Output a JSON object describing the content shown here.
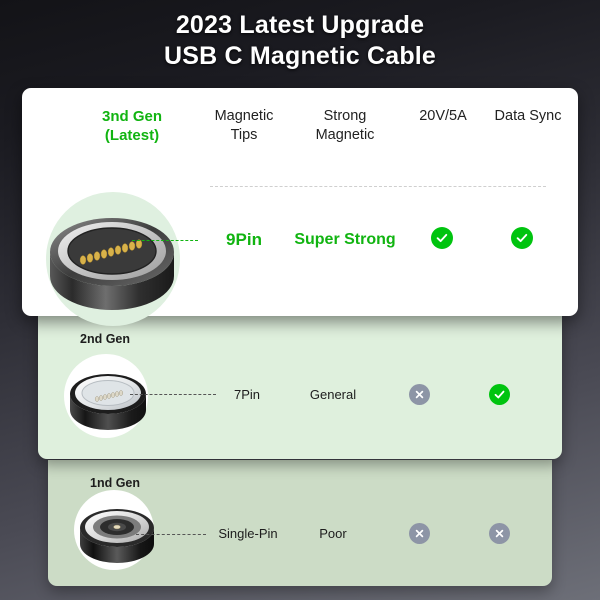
{
  "title": {
    "line1": "2023 Latest Upgrade",
    "line2": "USB C Magnetic Cable"
  },
  "colors": {
    "accent_green": "#11b411",
    "badge_ok": "#00c40f",
    "badge_no": "#8d95a6",
    "card_gen3_bg": "#ffffff",
    "card_gen2_bg": "#dff0dd",
    "card_gen1_bg": "#ccdcc6",
    "halo_green": "#dff0e0"
  },
  "columns": {
    "generation": "3nd Gen\n(Latest)",
    "generation_line1": "3nd Gen",
    "generation_line2": "(Latest)",
    "magnetic_tips_line1": "Magnetic",
    "magnetic_tips_line2": "Tips",
    "strong_magnetic_line1": "Strong",
    "strong_magnetic_line2": "Magnetic",
    "voltage": "20V/5A",
    "data_sync": "Data Sync"
  },
  "rows": [
    {
      "gen_label": "",
      "pins": "9Pin",
      "magnet_strength": "Super Strong",
      "voltage_support": "check",
      "data_sync_support": "check",
      "connector": "magnetic-connector-9pin"
    },
    {
      "gen_label": "2nd Gen",
      "pins": "7Pin",
      "magnet_strength": "General",
      "voltage_support": "cross",
      "data_sync_support": "check",
      "connector": "magnetic-connector-7pin"
    },
    {
      "gen_label": "1nd Gen",
      "pins": "Single-Pin",
      "magnet_strength": "Poor",
      "voltage_support": "cross",
      "data_sync_support": "cross",
      "connector": "magnetic-connector-single-pin"
    }
  ],
  "icons": {
    "check": "check-circle-icon",
    "cross": "cross-circle-icon"
  }
}
